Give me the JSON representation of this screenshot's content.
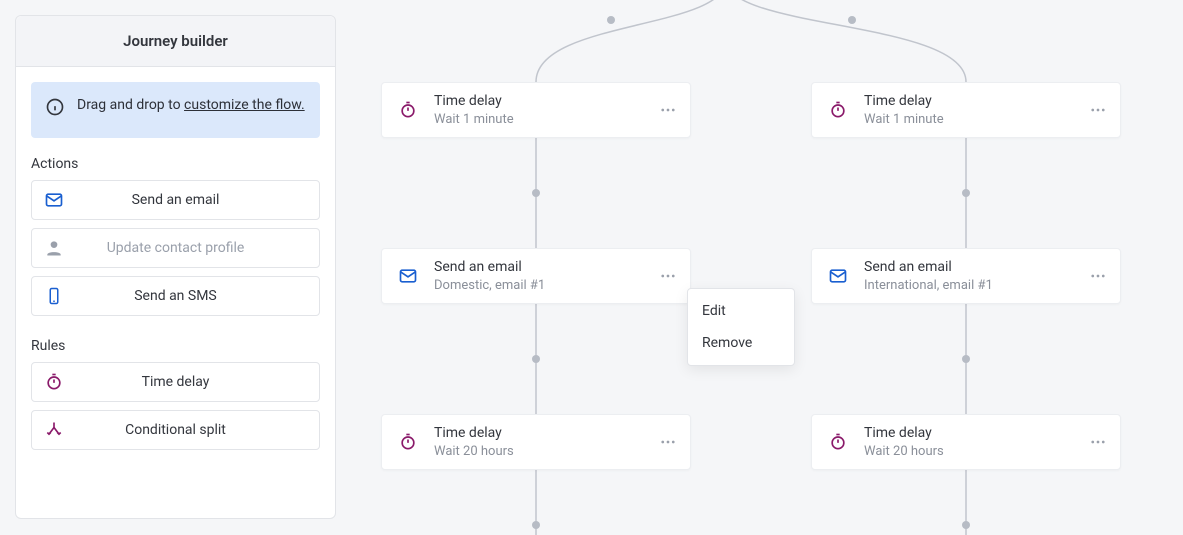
{
  "sidebar": {
    "title": "Journey builder",
    "info_prefix": "Drag and drop to ",
    "info_link": "customize the flow.",
    "actions_label": "Actions",
    "rules_label": "Rules",
    "actions": [
      {
        "label": "Send an email"
      },
      {
        "label": "Update contact profile"
      },
      {
        "label": "Send an SMS"
      }
    ],
    "rules": [
      {
        "label": "Time delay"
      },
      {
        "label": "Conditional split"
      }
    ]
  },
  "menu": {
    "edit": "Edit",
    "remove": "Remove"
  },
  "nodes": {
    "left": [
      {
        "title": "Time delay",
        "sub": "Wait 1 minute"
      },
      {
        "title": "Send an email",
        "sub": "Domestic, email #1"
      },
      {
        "title": "Time delay",
        "sub": "Wait 20 hours"
      }
    ],
    "right": [
      {
        "title": "Time delay",
        "sub": "Wait 1 minute"
      },
      {
        "title": "Send an email",
        "sub": "International, email #1"
      },
      {
        "title": "Time delay",
        "sub": "Wait 20 hours"
      }
    ]
  },
  "colors": {
    "brand_blue": "#1a5fd0",
    "brand_purple": "#8a1a6a",
    "muted": "#9aa0ab"
  }
}
